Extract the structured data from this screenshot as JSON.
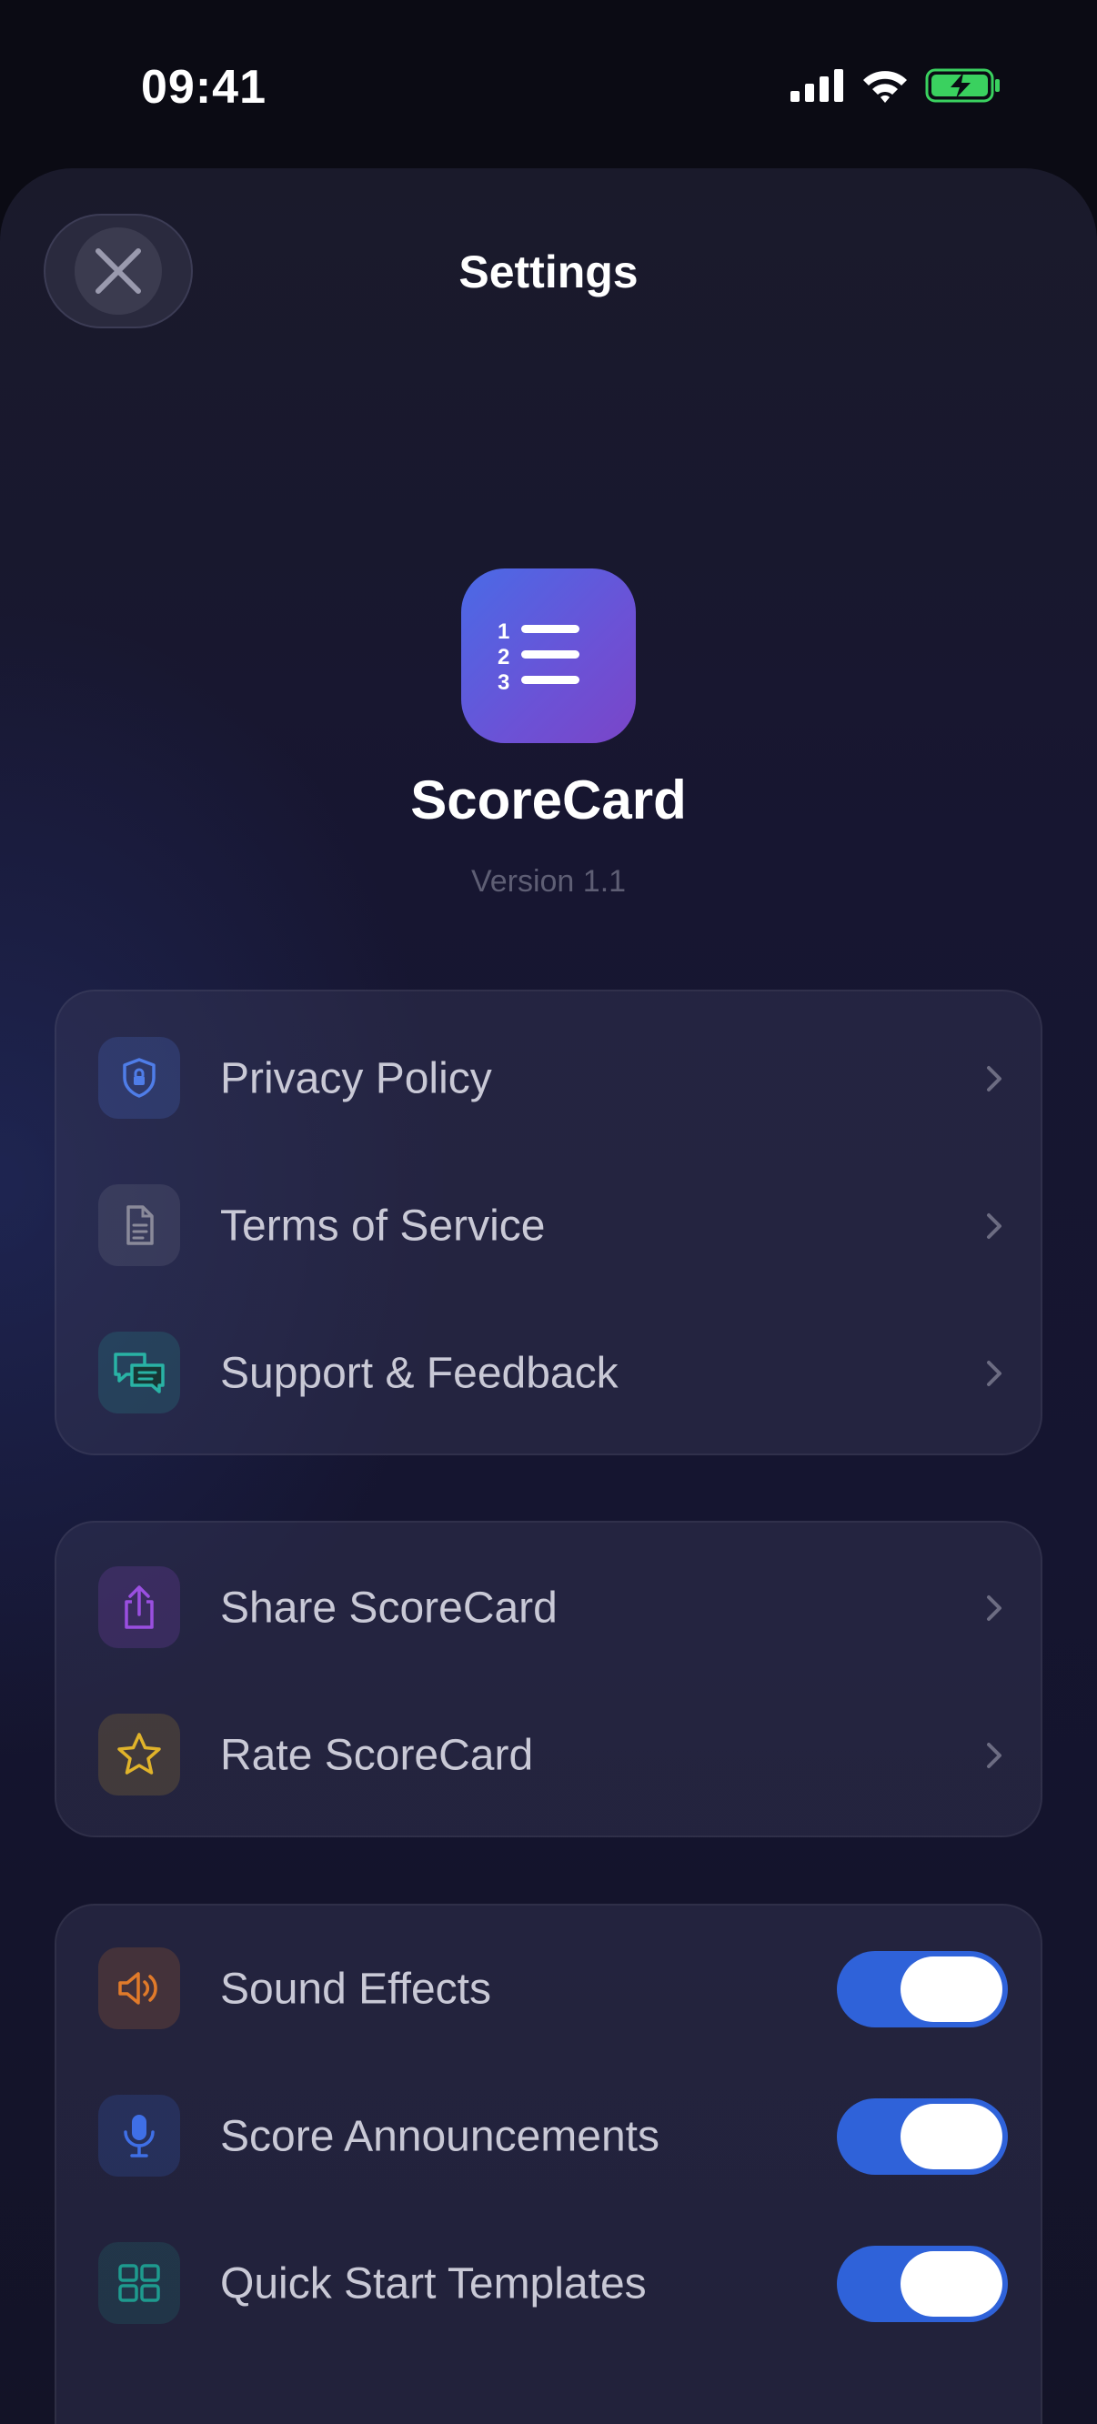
{
  "status": {
    "time": "09:41"
  },
  "header": {
    "title": "Settings"
  },
  "app": {
    "name": "ScoreCard",
    "version": "Version 1.1"
  },
  "groups": {
    "info": [
      {
        "label": "Privacy Policy",
        "icon": "shield-lock-icon",
        "color": "#4f7de8"
      },
      {
        "label": "Terms of Service",
        "icon": "document-icon",
        "color": "#8a8a9a"
      },
      {
        "label": "Support & Feedback",
        "icon": "chat-bubbles-icon",
        "color": "#29b3a5"
      }
    ],
    "share": [
      {
        "label": "Share ScoreCard",
        "icon": "share-icon",
        "color": "#9a4fe0"
      },
      {
        "label": "Rate ScoreCard",
        "icon": "star-icon",
        "color": "#e0b32a"
      }
    ],
    "toggles": [
      {
        "label": "Sound Effects",
        "icon": "speaker-icon",
        "color": "#e07a2a",
        "on": true
      },
      {
        "label": "Score Announcements",
        "icon": "microphone-icon",
        "color": "#3f6fe6",
        "on": true
      },
      {
        "label": "Quick Start Templates",
        "icon": "grid-icon",
        "color": "#1e9a8e",
        "on": true
      }
    ]
  },
  "colors": {
    "accent": "#2f62d9",
    "background": "#0b0b14"
  }
}
